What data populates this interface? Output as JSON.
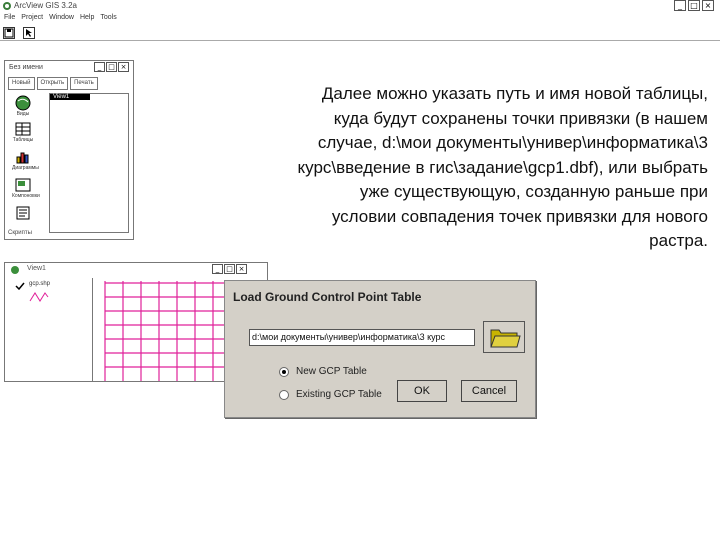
{
  "app": {
    "title": "ArcView GIS 3.2a",
    "menu": [
      "File",
      "Project",
      "Window",
      "Help",
      "Tools"
    ]
  },
  "project_window": {
    "title": "Без имени",
    "buttons": [
      "Новый",
      "Открыть",
      "Печать"
    ],
    "icons": [
      {
        "name": "views-icon",
        "label": "Виды"
      },
      {
        "name": "tables-icon",
        "label": "Таблицы"
      },
      {
        "name": "charts-icon",
        "label": "Диаграммы"
      },
      {
        "name": "layouts-icon",
        "label": "Компоновки"
      },
      {
        "name": "scripts-icon",
        "label": "Скрипты"
      }
    ],
    "list_items": [
      "View1"
    ],
    "bottom_label": "Скрипты"
  },
  "view_window": {
    "title": "View1",
    "layer_name": "gcp.shp"
  },
  "explanation_lines": [
    "Далее можно указать путь и имя новой таблицы,",
    "куда будут сохранены точки привязки (в нашем",
    "случае, d:\\мои документы\\универ\\информатика\\3",
    "курс\\введение в гис\\задание\\gcp1.dbf), или выбрать",
    "уже существующую, созданную раньше при",
    "условии совпадения точек привязки для нового",
    "растра."
  ],
  "dialog": {
    "title": "Load Ground Control Point Table",
    "path_value": "d:\\мои документы\\универ\\информатика\\3 курс",
    "option_new": "New GCP Table",
    "option_existing": "Existing GCP Table",
    "selected_option": "new",
    "ok_label": "OK",
    "cancel_label": "Cancel"
  },
  "colors": {
    "grid": "#e0209a",
    "dialog_bg": "#d4d0c8",
    "folder": "#c8b400"
  }
}
